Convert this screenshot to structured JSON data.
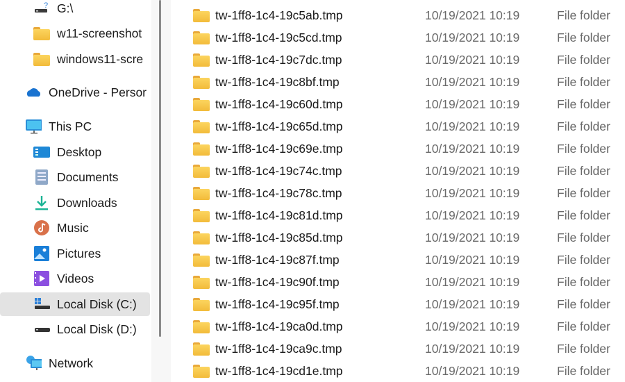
{
  "sidebar": {
    "items": [
      {
        "label": "G:\\",
        "icon": "network-drive-icon"
      },
      {
        "label": "w11-screenshot",
        "icon": "folder-icon"
      },
      {
        "label": "windows11-scre",
        "icon": "folder-icon"
      },
      {
        "label": "OneDrive - Persor",
        "icon": "onedrive-cloud-icon"
      },
      {
        "label": "This PC",
        "icon": "monitor-icon"
      },
      {
        "label": "Desktop",
        "icon": "desktop-icon"
      },
      {
        "label": "Documents",
        "icon": "documents-icon"
      },
      {
        "label": "Downloads",
        "icon": "download-icon"
      },
      {
        "label": "Music",
        "icon": "music-icon"
      },
      {
        "label": "Pictures",
        "icon": "pictures-icon"
      },
      {
        "label": "Videos",
        "icon": "videos-icon"
      },
      {
        "label": "Local Disk (C:)",
        "icon": "system-drive-icon",
        "selected": true
      },
      {
        "label": "Local Disk (D:)",
        "icon": "drive-icon"
      },
      {
        "label": "Network",
        "icon": "network-icon"
      }
    ]
  },
  "files": [
    {
      "name": "tw-1ff8-1c4-19c5ab.tmp",
      "date": "10/19/2021 10:19",
      "type": "File folder"
    },
    {
      "name": "tw-1ff8-1c4-19c5cd.tmp",
      "date": "10/19/2021 10:19",
      "type": "File folder"
    },
    {
      "name": "tw-1ff8-1c4-19c7dc.tmp",
      "date": "10/19/2021 10:19",
      "type": "File folder"
    },
    {
      "name": "tw-1ff8-1c4-19c8bf.tmp",
      "date": "10/19/2021 10:19",
      "type": "File folder"
    },
    {
      "name": "tw-1ff8-1c4-19c60d.tmp",
      "date": "10/19/2021 10:19",
      "type": "File folder"
    },
    {
      "name": "tw-1ff8-1c4-19c65d.tmp",
      "date": "10/19/2021 10:19",
      "type": "File folder"
    },
    {
      "name": "tw-1ff8-1c4-19c69e.tmp",
      "date": "10/19/2021 10:19",
      "type": "File folder"
    },
    {
      "name": "tw-1ff8-1c4-19c74c.tmp",
      "date": "10/19/2021 10:19",
      "type": "File folder"
    },
    {
      "name": "tw-1ff8-1c4-19c78c.tmp",
      "date": "10/19/2021 10:19",
      "type": "File folder"
    },
    {
      "name": "tw-1ff8-1c4-19c81d.tmp",
      "date": "10/19/2021 10:19",
      "type": "File folder"
    },
    {
      "name": "tw-1ff8-1c4-19c85d.tmp",
      "date": "10/19/2021 10:19",
      "type": "File folder"
    },
    {
      "name": "tw-1ff8-1c4-19c87f.tmp",
      "date": "10/19/2021 10:19",
      "type": "File folder"
    },
    {
      "name": "tw-1ff8-1c4-19c90f.tmp",
      "date": "10/19/2021 10:19",
      "type": "File folder"
    },
    {
      "name": "tw-1ff8-1c4-19c95f.tmp",
      "date": "10/19/2021 10:19",
      "type": "File folder"
    },
    {
      "name": "tw-1ff8-1c4-19ca0d.tmp",
      "date": "10/19/2021 10:19",
      "type": "File folder"
    },
    {
      "name": "tw-1ff8-1c4-19ca9c.tmp",
      "date": "10/19/2021 10:19",
      "type": "File folder"
    },
    {
      "name": "tw-1ff8-1c4-19cd1e.tmp",
      "date": "10/19/2021 10:19",
      "type": "File folder"
    }
  ]
}
